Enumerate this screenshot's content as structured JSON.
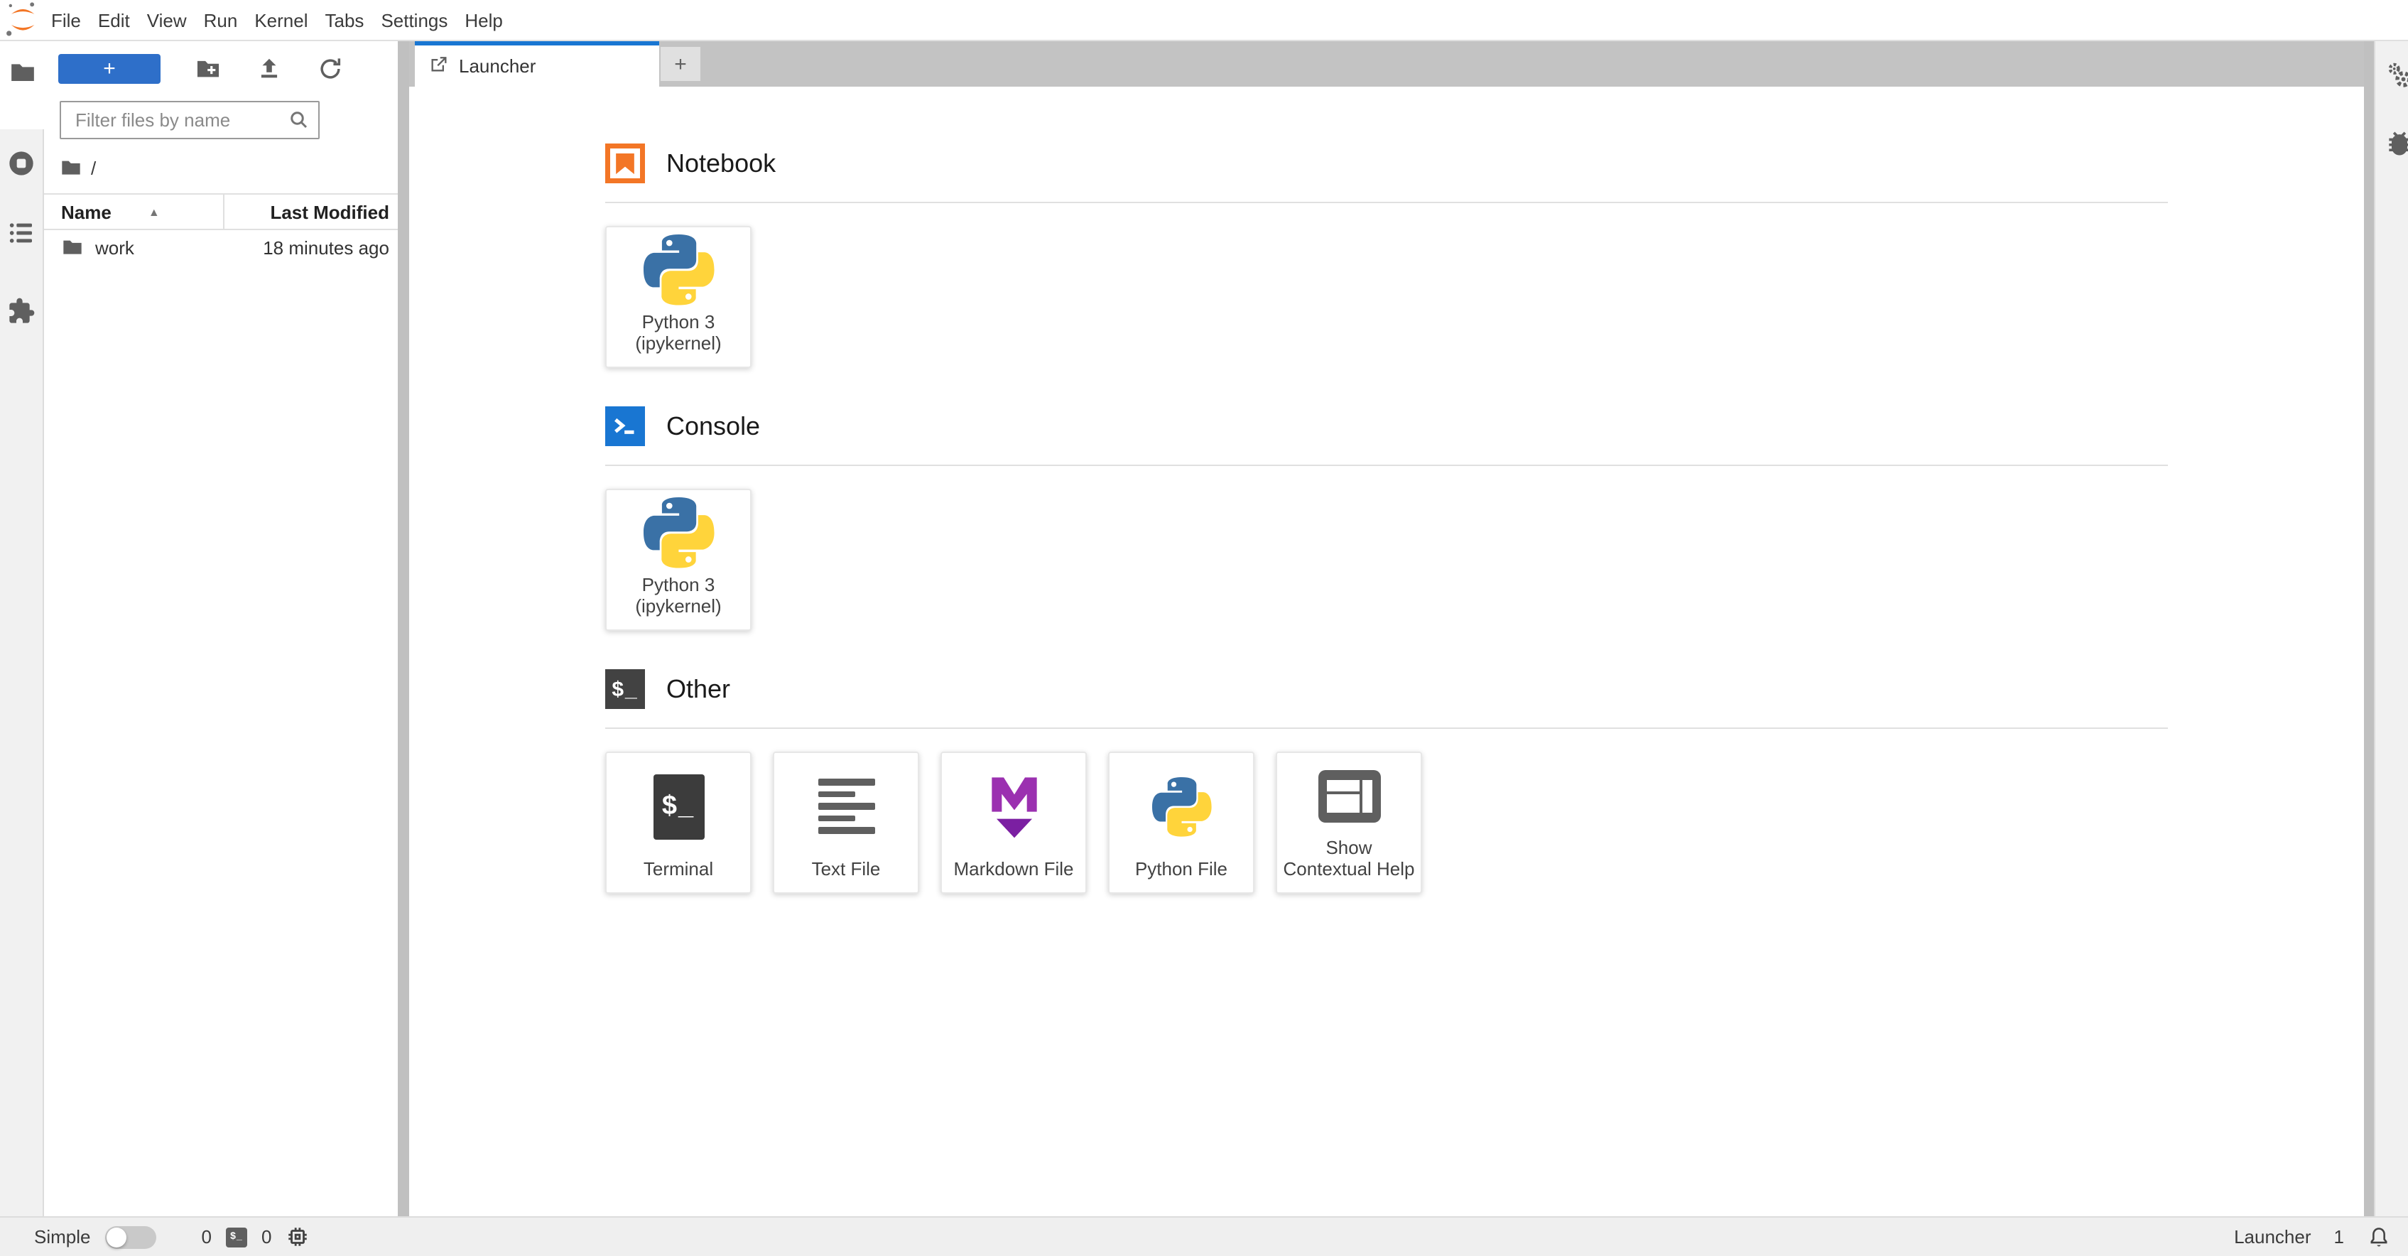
{
  "colors": {
    "accent_blue": "#1976d2",
    "jupyter_orange": "#F37626",
    "markdown_purple": "#8b2fa8",
    "dark_icon": "#424242",
    "tabbar_gray": "#c3c3c3",
    "panel_gray": "#f1f1f1"
  },
  "menubar": {
    "items": [
      "File",
      "Edit",
      "View",
      "Run",
      "Kernel",
      "Tabs",
      "Settings",
      "Help"
    ]
  },
  "left_sidebar_icons": [
    "folder-file-browser",
    "running-sessions",
    "table-of-contents",
    "extension-manager"
  ],
  "right_sidebar_icons": [
    "property-inspector-gears",
    "debugger-bug"
  ],
  "file_browser": {
    "filter_placeholder": "Filter files by name",
    "breadcrumb": "/",
    "columns": {
      "name": "Name",
      "modified": "Last Modified"
    },
    "rows": [
      {
        "name": "work",
        "modified": "18 minutes ago"
      }
    ]
  },
  "dock": {
    "tabs": [
      {
        "label": "Launcher"
      }
    ]
  },
  "launcher": {
    "sections": [
      {
        "title": "Notebook",
        "cards": [
          {
            "label": "Python 3 (ipykernel)",
            "icon": "python-logo"
          }
        ]
      },
      {
        "title": "Console",
        "cards": [
          {
            "label": "Python 3 (ipykernel)",
            "icon": "python-logo"
          }
        ]
      },
      {
        "title": "Other",
        "cards": [
          {
            "label": "Terminal",
            "icon": "terminal"
          },
          {
            "label": "Text File",
            "icon": "text-file"
          },
          {
            "label": "Markdown File",
            "icon": "markdown"
          },
          {
            "label": "Python File",
            "icon": "python-logo"
          },
          {
            "label": "Show Contextual Help",
            "icon": "contextual-help"
          }
        ]
      }
    ]
  },
  "statusbar": {
    "mode_label": "Simple",
    "terminals_count": "0",
    "kernels_count": "0",
    "context_label": "Launcher",
    "notifications_count": "1"
  },
  "glyphs": {
    "plus": "+",
    "prompt": "$_",
    "sort_asc": "▲"
  }
}
